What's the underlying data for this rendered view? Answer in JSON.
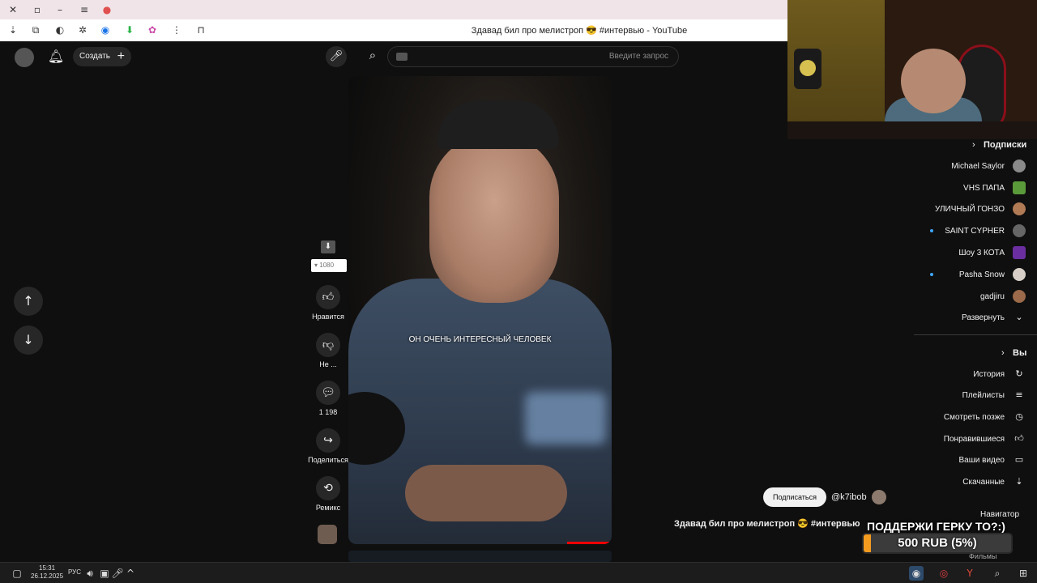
{
  "browser": {
    "page_title": "Здавад бил про мелистроп 😎 #интервью - YouTube"
  },
  "header": {
    "create_label": "Создать",
    "search_placeholder": "Введите запрос"
  },
  "video": {
    "subtitle": "ОН ОЧЕНЬ ИНТЕРЕСНЫЙ ЧЕЛОВЕК",
    "quality": "1080"
  },
  "actions": {
    "like_label": "Нравится",
    "dislike_label": "Не ...",
    "comments_count": "1 198",
    "share_label": "Поделиться",
    "remix_label": "Ремикс"
  },
  "sidebar": {
    "subscriptions_header": "Подписки",
    "subscriptions": [
      {
        "label": "Michael Saylor"
      },
      {
        "label": "VHS ПАПА"
      },
      {
        "label": "УЛИЧНЫЙ ГОНЗО"
      },
      {
        "label": "SAINT CYPHER"
      },
      {
        "label": "Шоу 3 КОТА"
      },
      {
        "label": "Pasha Snow"
      },
      {
        "label": "gadjiru"
      },
      {
        "label": "Развернуть"
      }
    ],
    "you_header": "Вы",
    "you_items": [
      {
        "label": "История"
      },
      {
        "label": "Плейлисты"
      },
      {
        "label": "Смотреть позже"
      },
      {
        "label": "Понравившиеся"
      },
      {
        "label": "Ваши видео"
      },
      {
        "label": "Скачанные"
      }
    ],
    "navigator_label": "Навигатор",
    "extra_label": "Фильмы"
  },
  "short": {
    "subscribe_label": "Подписаться",
    "channel_name": "@k7ibob",
    "title": "Здавад бил про мелистроп 😎 #интервью"
  },
  "donation": {
    "title": "ПОДДЕРЖИ ГЕРКУ ТО?:)",
    "amount_text": "500 RUB (5%)",
    "progress_fraction": 0.05,
    "bar_color": "#f39b1f"
  },
  "taskbar": {
    "time": "15:31",
    "date": "26.12.2025",
    "lang": "РУС"
  }
}
